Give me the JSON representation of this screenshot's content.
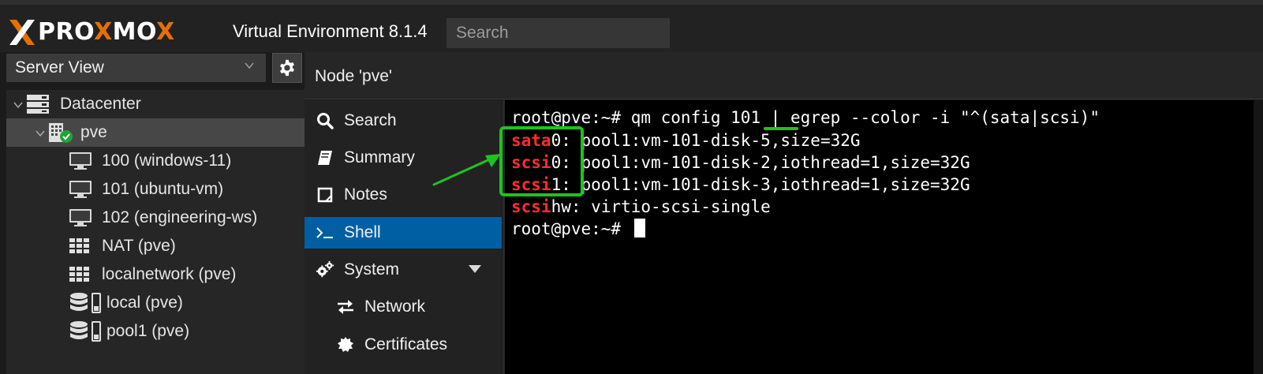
{
  "header": {
    "logo_white_1": "PRO",
    "logo_orange": "X",
    "logo_white_2": "MO",
    "logo_last": "X",
    "product": "Virtual Environment 8.1.4",
    "search_placeholder": "Search"
  },
  "sidebar": {
    "view_select": "Server View",
    "gear_icon": "gear-icon",
    "tree": [
      {
        "label": "Datacenter",
        "icon": "datacenter-icon"
      },
      {
        "label": "pve",
        "icon": "node-online-icon",
        "selected": true
      },
      {
        "label": "100 (windows-11)",
        "icon": "vm-icon"
      },
      {
        "label": "101 (ubuntu-vm)",
        "icon": "vm-icon"
      },
      {
        "label": "102 (engineering-ws)",
        "icon": "vm-icon"
      },
      {
        "label": "NAT (pve)",
        "icon": "network-icon"
      },
      {
        "label": "localnetwork (pve)",
        "icon": "network-icon"
      },
      {
        "label": "local (pve)",
        "icon": "storage-icon"
      },
      {
        "label": "pool1 (pve)",
        "icon": "storage-icon"
      }
    ]
  },
  "content": {
    "title": "Node 'pve'",
    "menu": [
      {
        "label": "Search",
        "icon": "search-icon"
      },
      {
        "label": "Summary",
        "icon": "book-icon"
      },
      {
        "label": "Notes",
        "icon": "notes-icon"
      },
      {
        "label": "Shell",
        "icon": "terminal-icon",
        "active": true
      },
      {
        "label": "System",
        "icon": "cogs-icon"
      },
      {
        "label": "Network",
        "icon": "exchange-icon"
      },
      {
        "label": "Certificates",
        "icon": "certificate-icon"
      }
    ]
  },
  "terminal": {
    "line1_prompt": "root@pve:~# ",
    "line1_cmd_a": "qm config ",
    "line1_vmid": "101",
    "line1_cmd_b": " | egrep --color -i \"^(sata|scsi)\"",
    "line2_key": "sata",
    "line2_rest": "0: pool1:vm-101-disk-5,size=32G",
    "line3_key": "scsi",
    "line3_rest": "0: pool1:vm-101-disk-2,iothread=1,size=32G",
    "line4_key": "scsi",
    "line4_rest": "1: pool1:vm-101-disk-3,iothread=1,size=32G",
    "line5_key": "scsi",
    "line5_rest": "hw: virtio-scsi-single",
    "line6_prompt": "root@pve:~# "
  },
  "colors": {
    "accent": "#005fa3",
    "logo_orange": "#e57000",
    "match_red": "#ff2d2d",
    "annotation_green": "#1fc21f"
  }
}
